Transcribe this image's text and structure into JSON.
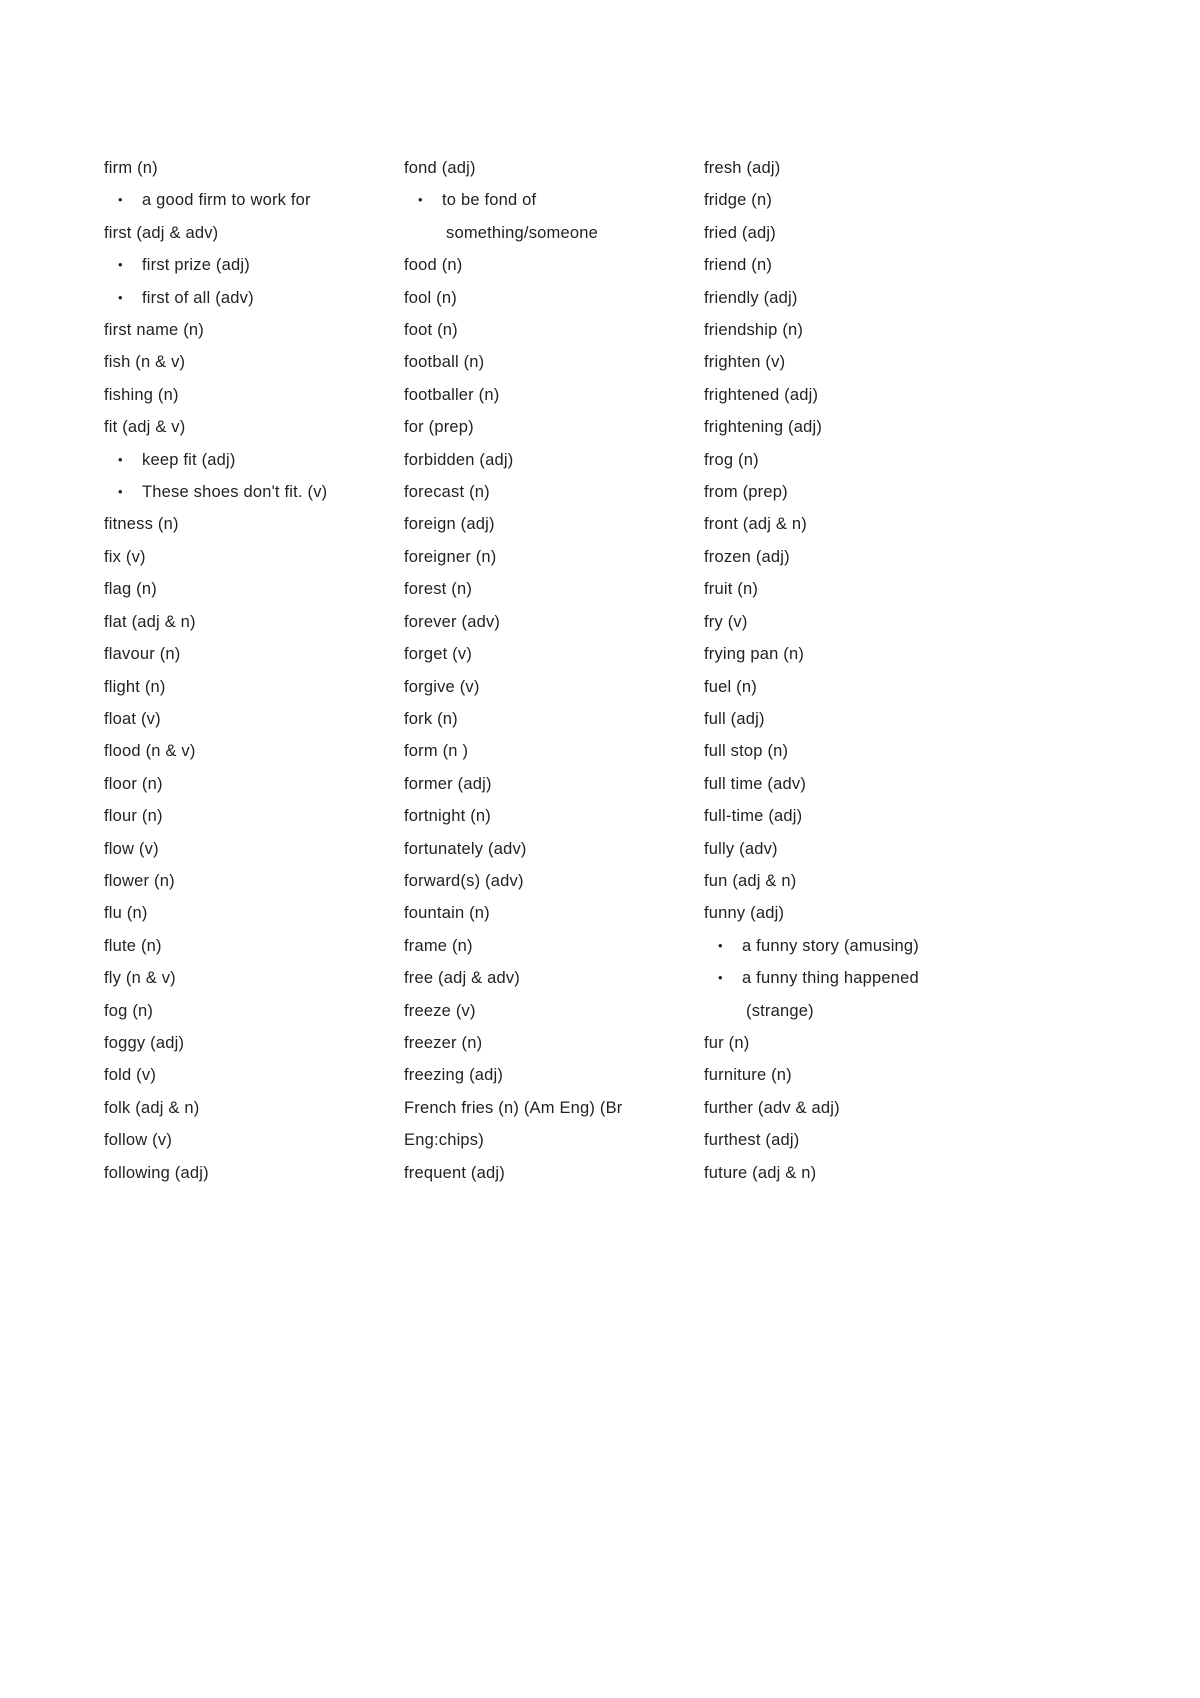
{
  "page": {
    "title": "Vocabulary word list - letter F",
    "background_color": "#ffffff",
    "text_color": "#231f20",
    "bullet_glyph": "•"
  },
  "columns": [
    {
      "id": "column-1",
      "lines": [
        {
          "type": "entry",
          "text": "firm  (n)"
        },
        {
          "type": "example",
          "text": "a good firm to work for"
        },
        {
          "type": "entry",
          "text": "first (adj  & adv)"
        },
        {
          "type": "example",
          "text": "first  prize  (adj)"
        },
        {
          "type": "example",
          "text": "first of all (adv)"
        },
        {
          "type": "entry",
          "text": "first name (n)"
        },
        {
          "type": "entry",
          "text": "fish (n & v)"
        },
        {
          "type": "entry",
          "text": "fishing  (n)"
        },
        {
          "type": "entry",
          "text": "fit (adj  & v)"
        },
        {
          "type": "example",
          "text": "keep  fit (adj)"
        },
        {
          "type": "example",
          "text": "These shoes don't fit. (v)"
        },
        {
          "type": "entry",
          "text": "fitness  (n)"
        },
        {
          "type": "entry",
          "text": "fix (v)"
        },
        {
          "type": "entry",
          "text": "flag (n)"
        },
        {
          "type": "entry",
          "text": "flat (adj  & n)"
        },
        {
          "type": "entry",
          "text": "flavour  (n)"
        },
        {
          "type": "entry",
          "text": "flight  (n)"
        },
        {
          "type": "entry",
          "text": "float  (v)"
        },
        {
          "type": "entry",
          "text": "flood (n & v)"
        },
        {
          "type": "entry",
          "text": "floor   (n)"
        },
        {
          "type": "entry",
          "text": "flour   (n)"
        },
        {
          "type": "entry",
          "text": "flow  (v)"
        },
        {
          "type": "entry",
          "text": "flower (n)"
        },
        {
          "type": "entry",
          "text": "flu (n)"
        },
        {
          "type": "entry",
          "text": "flute  (n)"
        },
        {
          "type": "entry",
          "text": "fly (n & v)"
        },
        {
          "type": "entry",
          "text": "fog  (n)"
        },
        {
          "type": "entry",
          "text": "foggy (adj)"
        },
        {
          "type": "entry",
          "text": "fold (v)"
        },
        {
          "type": "entry",
          "text": "folk (adj & n)"
        },
        {
          "type": "entry",
          "text": "follow (v)"
        },
        {
          "type": "entry",
          "text": "following  (adj)"
        }
      ]
    },
    {
      "id": "column-2",
      "lines": [
        {
          "type": "entry",
          "text": "fond  (adj)"
        },
        {
          "type": "example",
          "text": "to be fond of"
        },
        {
          "type": "contline",
          "text": "something/someone"
        },
        {
          "type": "entry",
          "text": "food  (n)"
        },
        {
          "type": "entry",
          "text": "fool (n)"
        },
        {
          "type": "entry",
          "text": "foot (n)"
        },
        {
          "type": "entry",
          "text": "football (n)"
        },
        {
          "type": "entry",
          "text": "footballer (n)"
        },
        {
          "type": "entry",
          "text": "for  (prep)"
        },
        {
          "type": "entry",
          "text": "forbidden  (adj)"
        },
        {
          "type": "entry",
          "text": "forecast (n)"
        },
        {
          "type": "entry",
          "text": "foreign  (adj)"
        },
        {
          "type": "entry",
          "text": "foreigner  (n)"
        },
        {
          "type": "entry",
          "text": "forest (n)"
        },
        {
          "type": "entry",
          "text": "forever (adv)"
        },
        {
          "type": "entry",
          "text": "forget (v)"
        },
        {
          "type": "entry",
          "text": "forgive  (v)"
        },
        {
          "type": "entry",
          "text": "fork  (n)"
        },
        {
          "type": "entry",
          "text": "form (n )"
        },
        {
          "type": "entry",
          "text": "former (adj)"
        },
        {
          "type": "entry",
          "text": "fortnight (n)"
        },
        {
          "type": "entry",
          "text": "fortunately (adv)"
        },
        {
          "type": "entry",
          "text": "forward(s) (adv)"
        },
        {
          "type": "entry",
          "text": "fountain (n)"
        },
        {
          "type": "entry",
          "text": "frame  (n)"
        },
        {
          "type": "entry",
          "text": "free (adj & adv)"
        },
        {
          "type": "entry",
          "text": "freeze (v)"
        },
        {
          "type": "entry",
          "text": "freezer (n)"
        },
        {
          "type": "entry",
          "text": "freezing (adj)"
        },
        {
          "type": "entry",
          "text": "French  fries (n) (Am  Eng) (Br"
        },
        {
          "type": "entry",
          "text": "Eng:chips)"
        },
        {
          "type": "entry",
          "text": "frequent  (adj)"
        }
      ]
    },
    {
      "id": "column-3",
      "lines": [
        {
          "type": "entry",
          "text": "fresh  (adj)"
        },
        {
          "type": "entry",
          "text": "fridge (n)"
        },
        {
          "type": "entry",
          "text": "fried (adj)"
        },
        {
          "type": "entry",
          "text": "friend (n)"
        },
        {
          "type": "entry",
          "text": "friendly (adj)"
        },
        {
          "type": "entry",
          "text": "friendship (n)"
        },
        {
          "type": "entry",
          "text": "frighten (v)"
        },
        {
          "type": "entry",
          "text": "frightened  (adj)"
        },
        {
          "type": "entry",
          "text": "frightening  (adj)"
        },
        {
          "type": "entry",
          "text": "frog  (n)"
        },
        {
          "type": "entry",
          "text": "from (prep)"
        },
        {
          "type": "entry",
          "text": "front (adj & n)"
        },
        {
          "type": "entry",
          "text": "frozen (adj)"
        },
        {
          "type": "entry",
          "text": "fruit (n)"
        },
        {
          "type": "entry",
          "text": "fry (v)"
        },
        {
          "type": "entry",
          "text": "frying  pan (n)"
        },
        {
          "type": "entry",
          "text": "fuel (n)"
        },
        {
          "type": "entry",
          "text": "full (adj)"
        },
        {
          "type": "entry",
          "text": "full stop (n)"
        },
        {
          "type": "entry",
          "text": "full time  (adv)"
        },
        {
          "type": "entry",
          "text": "full-time  (adj)"
        },
        {
          "type": "entry",
          "text": "fully  (adv)"
        },
        {
          "type": "entry",
          "text": "fun (adj  & n)"
        },
        {
          "type": "entry",
          "text": "funny (adj)"
        },
        {
          "type": "example",
          "text": "a funny story (amusing)"
        },
        {
          "type": "example",
          "text": "a funny thing happened"
        },
        {
          "type": "contline",
          "text": "(strange)"
        },
        {
          "type": "entry",
          "text": "fur (n)"
        },
        {
          "type": "entry",
          "text": "furniture (n)"
        },
        {
          "type": "entry",
          "text": "further (adv & adj)"
        },
        {
          "type": "entry",
          "text": "furthest (adj)"
        },
        {
          "type": "entry",
          "text": "future (adj & n)"
        }
      ]
    }
  ]
}
